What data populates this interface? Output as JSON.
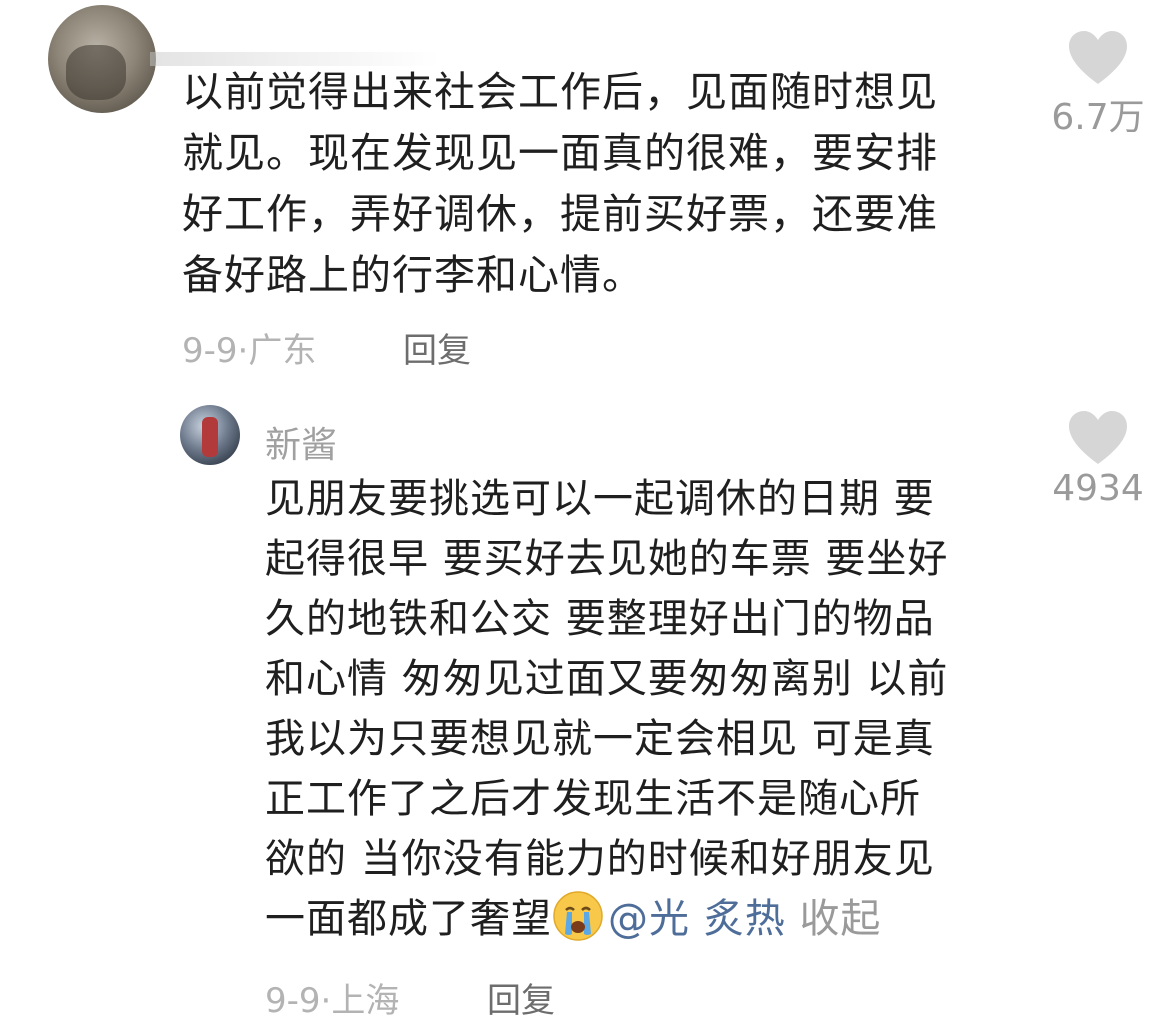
{
  "comments": [
    {
      "lines": [
        "以前觉得出来社会工作后，见面随时想见",
        "就见。现在发现见一面真的很难，要安排",
        "好工作，弄好调休，提前买好票，还要准",
        "备好路上的行李和心情。"
      ],
      "date": "9-9",
      "location": "广东",
      "reply_label": "回复",
      "likes": "6.7万"
    },
    {
      "username": "新酱",
      "lines": [
        "见朋友要挑选可以一起调休的日期 要",
        "起得很早 要买好去见她的车票 要坐好",
        "久的地铁和公交 要整理好出门的物品",
        "和心情 匆匆见过面又要匆匆离别 以前",
        "我以为只要想见就一定会相见 可是真",
        "正工作了之后才发现生活不是随心所",
        "欲的 当你没有能力的时候和好朋友见"
      ],
      "last_line_text": "一面都成了奢望",
      "emoji": "crying-face",
      "mention": "@光 炙热",
      "collapse_label": "收起",
      "date": "9-9",
      "location": "上海",
      "reply_label": "回复",
      "likes": "4934"
    }
  ],
  "colors": {
    "text": "#1f1f1f",
    "meta": "#b3b3b3",
    "reply": "#6d6d6d",
    "heart": "#d6d6d6",
    "mention": "#4e6d99"
  }
}
